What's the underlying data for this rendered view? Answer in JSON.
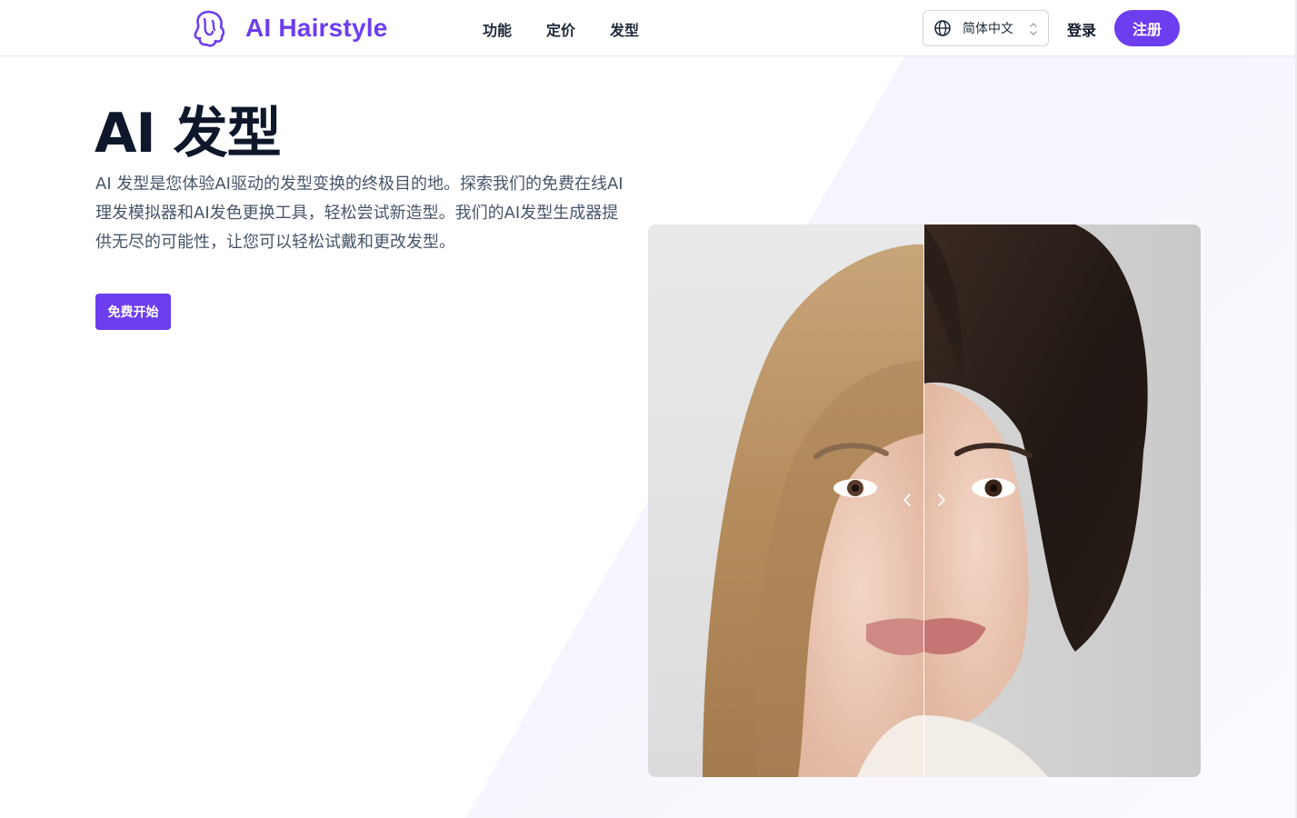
{
  "header": {
    "brand": "AI Hairstyle",
    "nav": [
      {
        "label": "功能"
      },
      {
        "label": "定价"
      },
      {
        "label": "发型"
      }
    ],
    "language": {
      "selected": "简体中文"
    },
    "login_label": "登录",
    "signup_label": "注册"
  },
  "hero": {
    "title": "AI 发型",
    "description": "AI 发型是您体验AI驱动的发型变换的终极目的地。探索我们的免费在线AI理发模拟器和AI发色更换工具，轻松尝试新造型。我们的AI发型生成器提供无尽的可能性，让您可以轻松试戴和更改发型。",
    "cta_label": "免费开始"
  },
  "colors": {
    "brand": "#6d3df0",
    "title": "#0f172a",
    "body_text": "#475569"
  },
  "icons": {
    "logo": "hair-logo-icon",
    "language": "globe-icon",
    "language_toggle": "chevron-updown-icon",
    "slider_left": "chevron-left-icon",
    "slider_right": "chevron-right-icon"
  }
}
